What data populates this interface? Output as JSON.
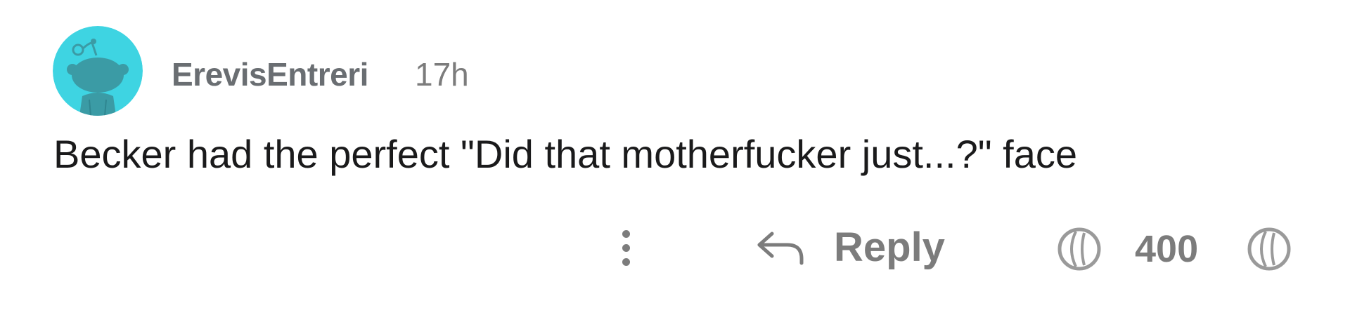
{
  "comment": {
    "author": "ErevisEntreri",
    "age": "17h",
    "avatar_icon": "snoo-avatar-icon",
    "body": "Becker had the perfect \"Did that motherfucker just...?\" face"
  },
  "actions": {
    "more_icon": "vertical-ellipsis-icon",
    "reply_icon": "reply-arrow-icon",
    "reply_label": "Reply",
    "upvote_icon": "upvote-icon",
    "vote_count": "400",
    "downvote_icon": "downvote-icon"
  },
  "colors": {
    "avatar_background": "#3ed4e2",
    "avatar_figure": "#3b9ba5",
    "username": "#6a6e72",
    "muted": "#7c7c7c",
    "body_text": "#1a1a1b",
    "page_background": "#ffffff"
  }
}
